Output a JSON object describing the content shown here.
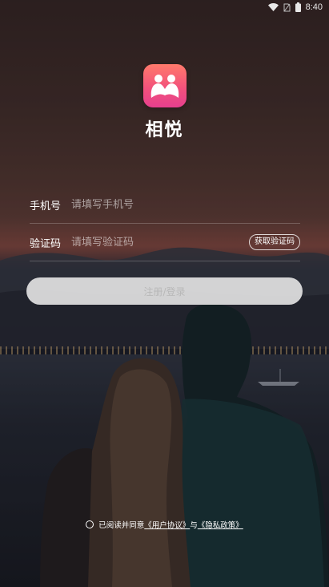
{
  "status_bar": {
    "time": "8:40",
    "icons": [
      "wifi-icon",
      "no-sim-icon",
      "battery-icon"
    ]
  },
  "app": {
    "logo_icon": "couple-logo-icon",
    "name": "相悦"
  },
  "form": {
    "phone": {
      "label": "手机号",
      "placeholder": "请填写手机号",
      "value": ""
    },
    "code": {
      "label": "验证码",
      "placeholder": "请填写验证码",
      "value": "",
      "get_code_label": "获取验证码"
    },
    "submit_label": "注册/登录"
  },
  "agreement": {
    "prefix": "已阅读并同意",
    "user_agreement": "《用户协议》",
    "conjunction": "与",
    "privacy_policy": "《隐私政策》",
    "checked": false
  },
  "colors": {
    "logo_top": "#ff7a6b",
    "logo_bottom": "#e63f8e",
    "button_bg": "#e2e2e2",
    "button_text": "#b8b8b8"
  }
}
